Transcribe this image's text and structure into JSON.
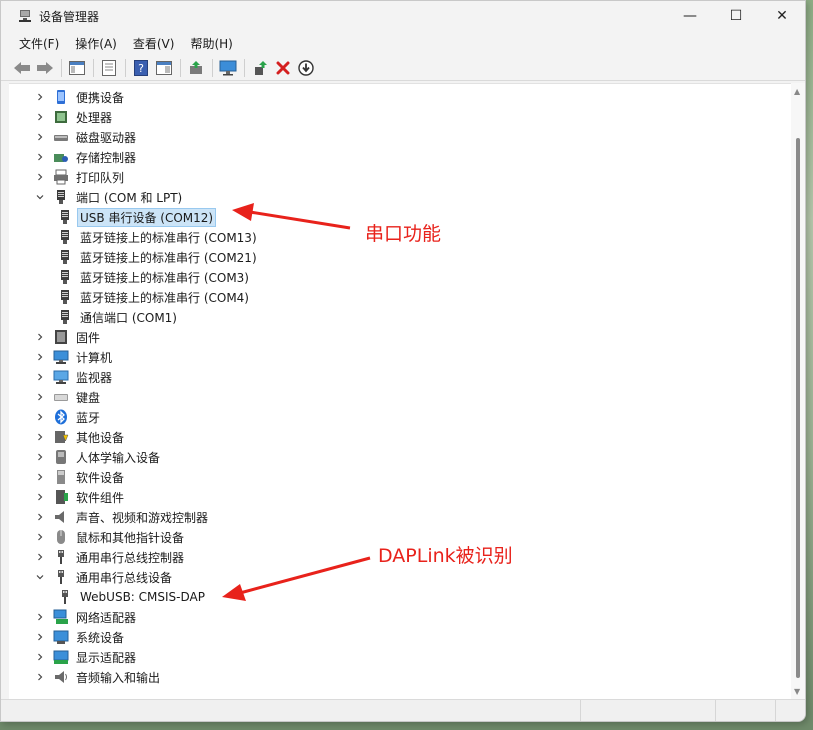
{
  "window": {
    "title": "设备管理器",
    "controls": {
      "minimize": "—",
      "maximize": "☐",
      "close": "✕"
    }
  },
  "menu": [
    "文件(F)",
    "操作(A)",
    "查看(V)",
    "帮助(H)"
  ],
  "toolbar_icons": [
    "back-icon",
    "forward-icon",
    "show-hide-console-tree-icon",
    "properties-icon",
    "help-icon",
    "action-pane-icon",
    "update-driver-icon",
    "scan-hardware-icon",
    "enable-device-icon",
    "uninstall-icon",
    "download-icon"
  ],
  "tree": [
    {
      "label": "便携设备",
      "expanded": false,
      "icon": "portable-device-icon",
      "depth": 0
    },
    {
      "label": "处理器",
      "expanded": false,
      "icon": "processor-icon",
      "depth": 0
    },
    {
      "label": "磁盘驱动器",
      "expanded": false,
      "icon": "disk-drive-icon",
      "depth": 0
    },
    {
      "label": "存储控制器",
      "expanded": false,
      "icon": "storage-controller-icon",
      "depth": 0
    },
    {
      "label": "打印队列",
      "expanded": false,
      "icon": "printer-icon",
      "depth": 0
    },
    {
      "label": "端口 (COM 和 LPT)",
      "expanded": true,
      "icon": "port-icon",
      "depth": 0
    },
    {
      "label": "USB 串行设备 (COM12)",
      "icon": "port-icon",
      "depth": 1,
      "selected": true
    },
    {
      "label": "蓝牙链接上的标准串行 (COM13)",
      "icon": "port-icon",
      "depth": 1
    },
    {
      "label": "蓝牙链接上的标准串行 (COM21)",
      "icon": "port-icon",
      "depth": 1
    },
    {
      "label": "蓝牙链接上的标准串行 (COM3)",
      "icon": "port-icon",
      "depth": 1
    },
    {
      "label": "蓝牙链接上的标准串行 (COM4)",
      "icon": "port-icon",
      "depth": 1
    },
    {
      "label": "通信端口 (COM1)",
      "icon": "port-icon",
      "depth": 1
    },
    {
      "label": "固件",
      "expanded": false,
      "icon": "firmware-icon",
      "depth": 0
    },
    {
      "label": "计算机",
      "expanded": false,
      "icon": "computer-icon",
      "depth": 0
    },
    {
      "label": "监视器",
      "expanded": false,
      "icon": "monitor-icon",
      "depth": 0
    },
    {
      "label": "键盘",
      "expanded": false,
      "icon": "keyboard-icon",
      "depth": 0
    },
    {
      "label": "蓝牙",
      "expanded": false,
      "icon": "bluetooth-icon",
      "depth": 0
    },
    {
      "label": "其他设备",
      "expanded": false,
      "icon": "other-device-icon",
      "depth": 0
    },
    {
      "label": "人体学输入设备",
      "expanded": false,
      "icon": "hid-icon",
      "depth": 0
    },
    {
      "label": "软件设备",
      "expanded": false,
      "icon": "software-device-icon",
      "depth": 0
    },
    {
      "label": "软件组件",
      "expanded": false,
      "icon": "software-component-icon",
      "depth": 0
    },
    {
      "label": "声音、视频和游戏控制器",
      "expanded": false,
      "icon": "speaker-icon",
      "depth": 0
    },
    {
      "label": "鼠标和其他指针设备",
      "expanded": false,
      "icon": "mouse-icon",
      "depth": 0
    },
    {
      "label": "通用串行总线控制器",
      "expanded": false,
      "icon": "usb-icon",
      "depth": 0
    },
    {
      "label": "通用串行总线设备",
      "expanded": true,
      "icon": "usb-icon",
      "depth": 0
    },
    {
      "label": "WebUSB: CMSIS-DAP",
      "icon": "usb-icon",
      "depth": 1
    },
    {
      "label": "网络适配器",
      "expanded": false,
      "icon": "network-adapter-icon",
      "depth": 0
    },
    {
      "label": "系统设备",
      "expanded": false,
      "icon": "system-device-icon",
      "depth": 0
    },
    {
      "label": "显示适配器",
      "expanded": false,
      "icon": "display-adapter-icon",
      "depth": 0
    },
    {
      "label": "音频输入和输出",
      "expanded": false,
      "icon": "audio-io-icon",
      "depth": 0
    }
  ],
  "annotations": {
    "serial": "串口功能",
    "daplink": "DAPLink被识别",
    "color": "#e8221b"
  },
  "colors": {
    "selection_bg": "#cce4f7",
    "selection_border": "#99c9ef"
  }
}
